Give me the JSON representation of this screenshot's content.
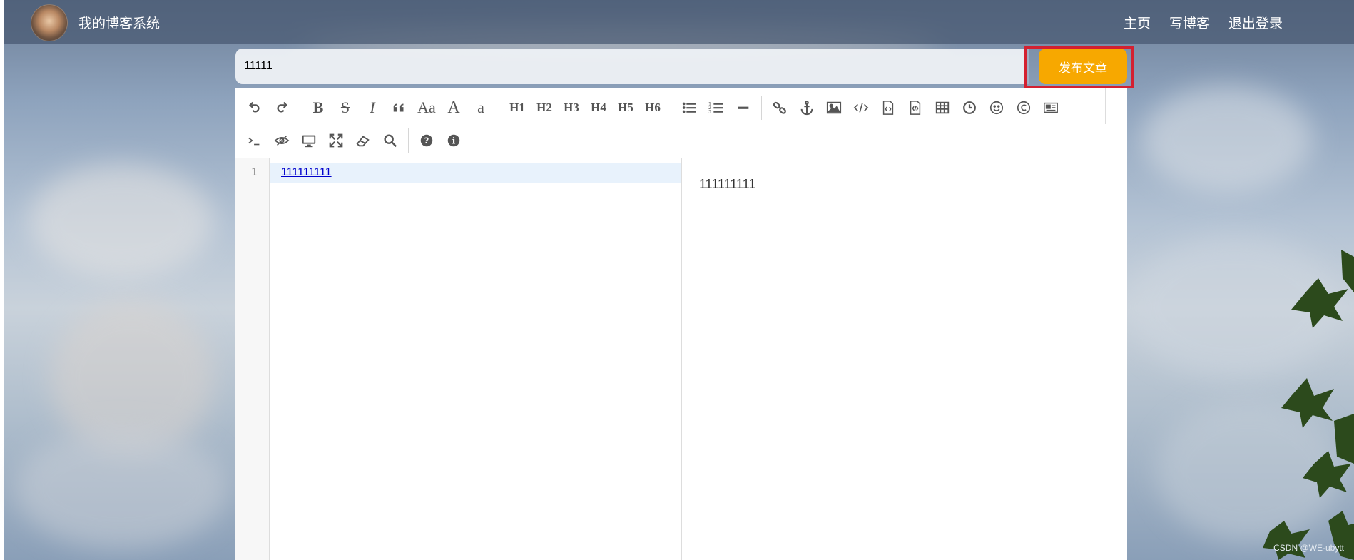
{
  "header": {
    "site_title": "我的博客系统",
    "nav": [
      "主页",
      "写博客",
      "退出登录"
    ]
  },
  "title_input": {
    "value": "11111"
  },
  "publish_button": {
    "label": "发布文章",
    "color": "#f7a800",
    "highlight_color": "#d42030"
  },
  "toolbar": {
    "row1": [
      {
        "name": "undo-icon"
      },
      {
        "name": "redo-icon"
      },
      {
        "sep": true
      },
      {
        "name": "bold-icon",
        "text": "B"
      },
      {
        "name": "strikethrough-icon",
        "text": "S"
      },
      {
        "name": "italic-icon",
        "text": "I"
      },
      {
        "name": "quote-icon"
      },
      {
        "name": "uppercase-icon",
        "text": "Aa"
      },
      {
        "name": "ucwords-icon",
        "text": "A"
      },
      {
        "name": "lowercase-icon",
        "text": "a"
      },
      {
        "sep": true
      },
      {
        "name": "h1-button",
        "text": "H1"
      },
      {
        "name": "h2-button",
        "text": "H2"
      },
      {
        "name": "h3-button",
        "text": "H3"
      },
      {
        "name": "h4-button",
        "text": "H4"
      },
      {
        "name": "h5-button",
        "text": "H5"
      },
      {
        "name": "h6-button",
        "text": "H6"
      },
      {
        "sep": true
      },
      {
        "name": "unordered-list-icon"
      },
      {
        "name": "ordered-list-icon"
      },
      {
        "name": "horizontal-rule-icon"
      },
      {
        "sep": true
      },
      {
        "name": "link-icon"
      },
      {
        "name": "anchor-icon"
      },
      {
        "name": "image-icon"
      },
      {
        "name": "code-icon"
      },
      {
        "name": "preformatted-code-icon"
      },
      {
        "name": "code-block-icon"
      },
      {
        "name": "table-icon"
      },
      {
        "name": "datetime-icon"
      },
      {
        "name": "emoji-icon"
      },
      {
        "name": "html-entities-icon"
      },
      {
        "name": "pagebreak-icon"
      }
    ],
    "row2": [
      {
        "name": "goto-line-icon"
      },
      {
        "name": "watch-icon"
      },
      {
        "name": "preview-icon"
      },
      {
        "name": "fullscreen-icon"
      },
      {
        "name": "clear-icon"
      },
      {
        "name": "search-icon"
      },
      {
        "sep": true
      },
      {
        "name": "help-icon"
      },
      {
        "name": "info-icon"
      }
    ]
  },
  "editor": {
    "line_numbers": [
      "1"
    ],
    "code_line": "111111111",
    "preview_text": "111111111"
  },
  "watermark": "CSDN @WE-ubytt"
}
